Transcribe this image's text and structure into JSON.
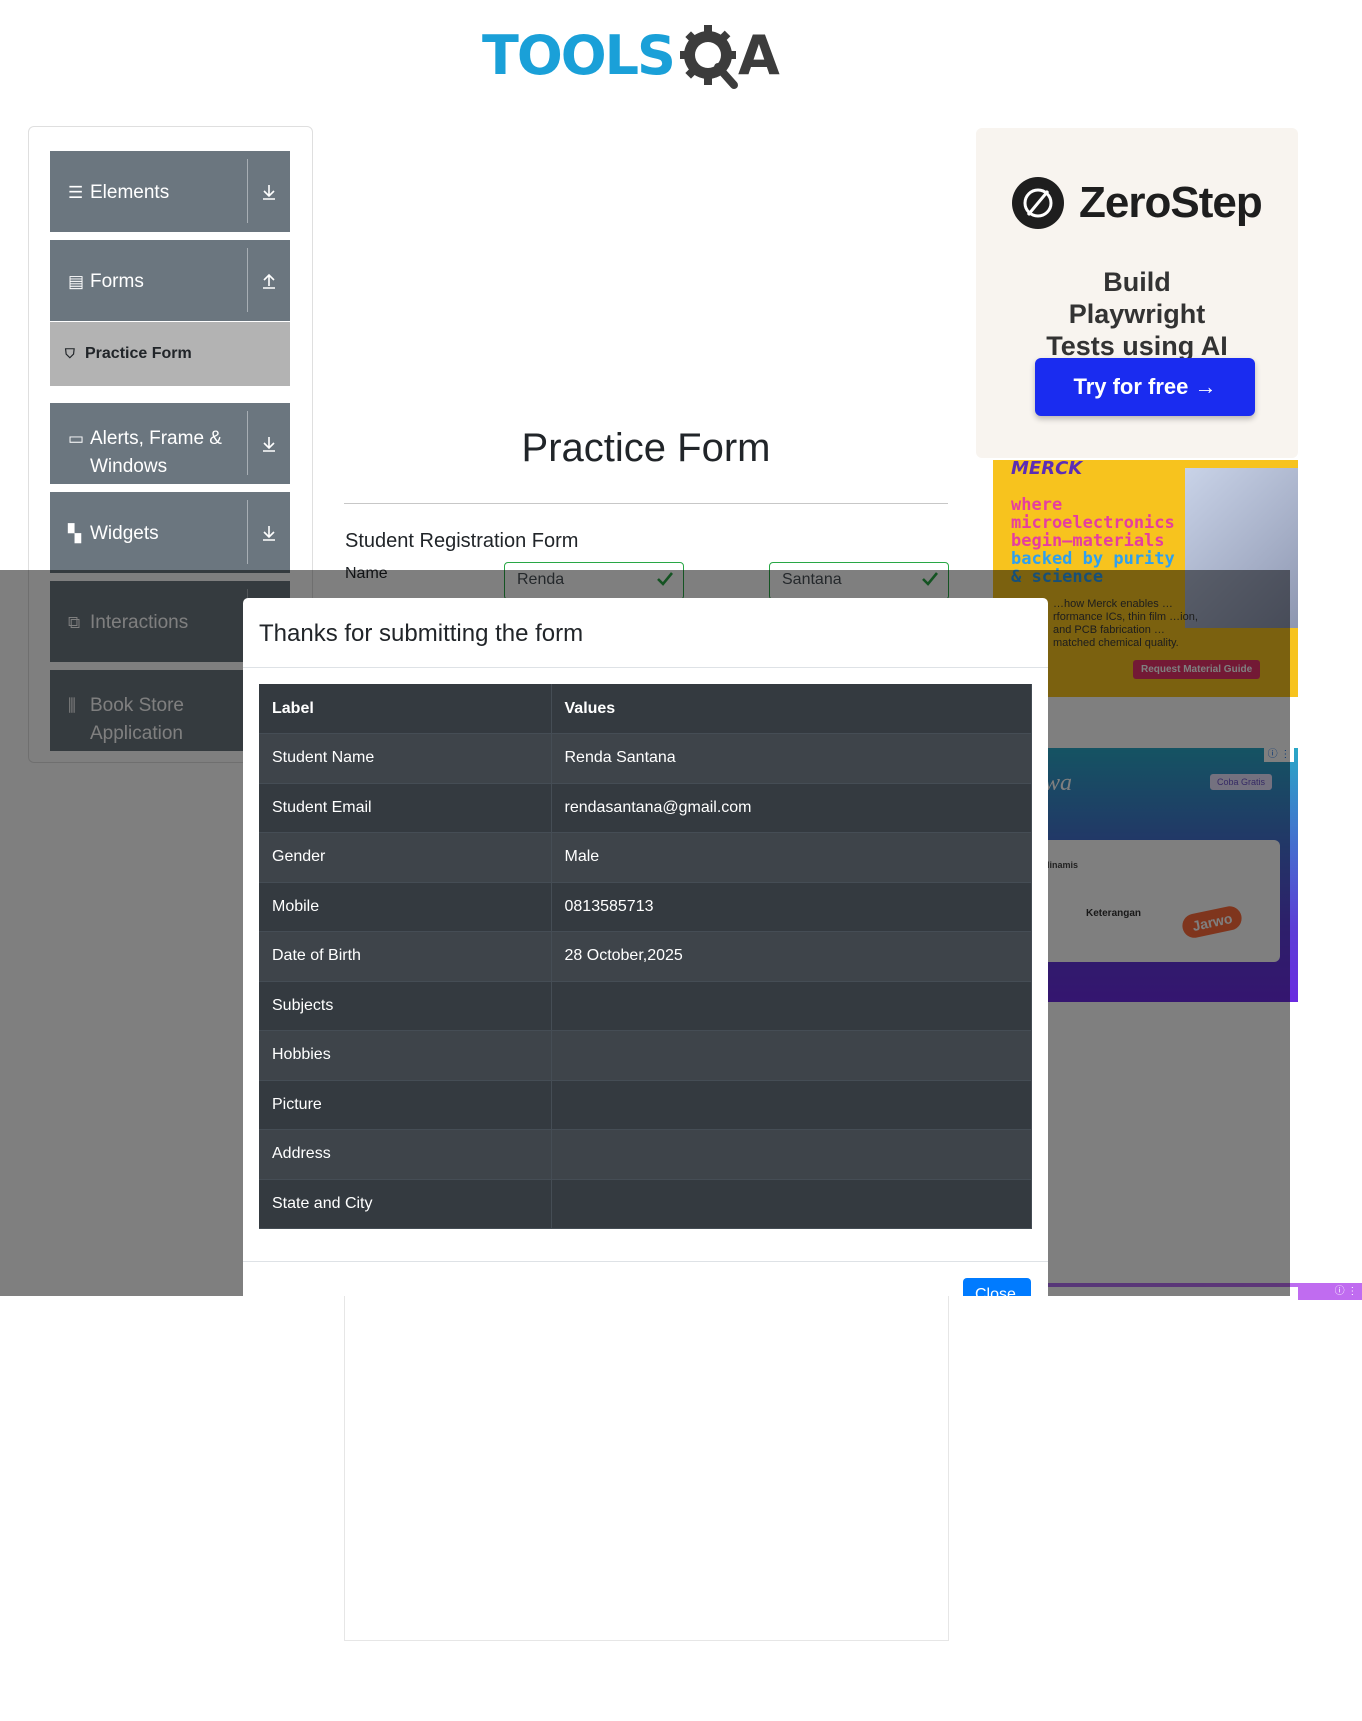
{
  "header": {
    "logo_text_left": "TOOLS",
    "logo_text_right": "A",
    "logo_colors": {
      "primary": "#1aa0d8",
      "dark": "#3c3c3c"
    }
  },
  "sidebar": {
    "groups": [
      {
        "label": "Elements",
        "icon": "menu-icon",
        "arrow": "download-arrow-icon"
      },
      {
        "label": "Forms",
        "icon": "document-icon",
        "arrow": "upload-arrow-icon"
      },
      {
        "label": "Alerts, Frame & Windows",
        "icon": "window-icon",
        "arrow": "download-arrow-icon"
      },
      {
        "label": "Widgets",
        "icon": "widgets-icon",
        "arrow": "download-arrow-icon"
      },
      {
        "label": "Interactions",
        "icon": "interactions-icon",
        "arrow": "download-arrow-icon"
      },
      {
        "label": "Book Store Application",
        "icon": "books-icon",
        "arrow": "download-arrow-icon"
      }
    ],
    "active_item": {
      "label": "Practice Form",
      "icon": "html5-icon"
    },
    "colors": {
      "group_bg": "#6b767f",
      "active_bg": "#b3b3b3"
    }
  },
  "main": {
    "title": "Practice Form",
    "form_title": "Student Registration Form",
    "name_label": "Name",
    "first_name_value": "Renda",
    "last_name_value": "Santana",
    "valid_color": "#28a745"
  },
  "ads": {
    "zerostep": {
      "brand": "ZeroStep",
      "tagline": "Build Playwright Tests using AI",
      "button": "Try for free →"
    },
    "merck": {
      "brand": "MERCK",
      "headline_pink": "where microelectronics begin—materials",
      "headline_blue": "backed by purity & science",
      "body": "…how Merck enables …rformance ICs, thin film …ion, and PCB fabrication …matched chemical quality.",
      "cta": "Request Material Guide"
    },
    "jarwo": {
      "logo": "wa",
      "button": "Coba Gratis",
      "card_label": "dinamis",
      "card_text": "Keterangan",
      "chip": "Jarwo"
    }
  },
  "modal": {
    "title": "Thanks for submitting the form",
    "close_label": "Close",
    "table": {
      "headers": [
        "Label",
        "Values"
      ],
      "rows": [
        [
          "Student Name",
          "Renda Santana"
        ],
        [
          "Student Email",
          "rendasantana@gmail.com"
        ],
        [
          "Gender",
          "Male"
        ],
        [
          "Mobile",
          "0813585713"
        ],
        [
          "Date of Birth",
          "28 October,2025"
        ],
        [
          "Subjects",
          ""
        ],
        [
          "Hobbies",
          ""
        ],
        [
          "Picture",
          ""
        ],
        [
          "Address",
          ""
        ],
        [
          "State and City",
          ""
        ]
      ]
    },
    "colors": {
      "table_dark": "#343a40",
      "close_button": "#007bff"
    }
  }
}
